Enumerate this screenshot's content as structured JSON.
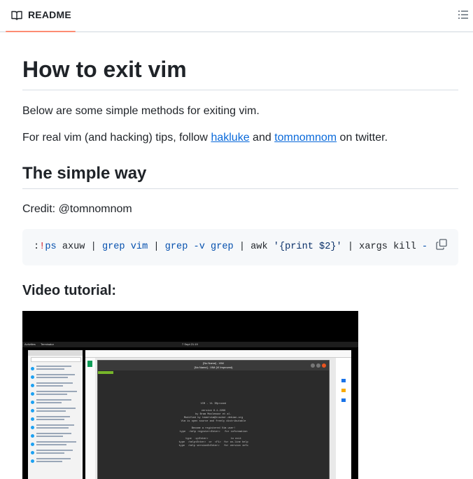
{
  "header": {
    "tab_label": "README",
    "tab_icon": "book-icon",
    "toc_icon": "list-icon",
    "accent_color": "#fd8c73"
  },
  "article": {
    "title": "How to exit vim",
    "intro": "Below are some simple methods for exiting vim.",
    "follow_prefix": "For real vim (and hacking) tips, follow ",
    "link1": "hakluke",
    "follow_mid": " and ",
    "link2": "tomnomnom",
    "follow_suffix": " on twitter.",
    "section1_title": "The simple way",
    "credit": "Credit: @tomnomnom",
    "code": {
      "t1": ":",
      "t2": "!",
      "t3": "ps",
      "t4": " axuw | ",
      "t5": "grep",
      "t6": " ",
      "t7": "vim",
      "t8": " | ",
      "t9": "grep",
      "t10": " ",
      "t11": "-v",
      "t12": " ",
      "t13": "grep",
      "t14": " | awk ",
      "t15": "'{print $2}'",
      "t16": " | xargs kill ",
      "t17": "-"
    },
    "copy_icon": "copy-icon",
    "video_heading": "Video tutorial:"
  },
  "video": {
    "topbar_left": "Activities",
    "topbar_app": "Terminator",
    "topbar_clock": "7 Sept 21:19",
    "vim_title": "[No Name] - VIM",
    "vim_subtitle": "[No Name] - VIM (Vi Improved)",
    "vim_splash": [
      "VIM - Vi IMproved",
      "",
      "version 8.1.2269",
      "by Bram Moolenaar et al.",
      "Modified by team+vim@tracker.debian.org",
      "Vim is open source and freely distributable",
      "",
      "Become a registered Vim user!",
      "type  :help register<Enter>   for information",
      "",
      "type  :q<Enter>               to exit",
      "type  :help<Enter>  or  <F1>  for on-line help",
      "type  :help version8<Enter>   for version info"
    ]
  }
}
